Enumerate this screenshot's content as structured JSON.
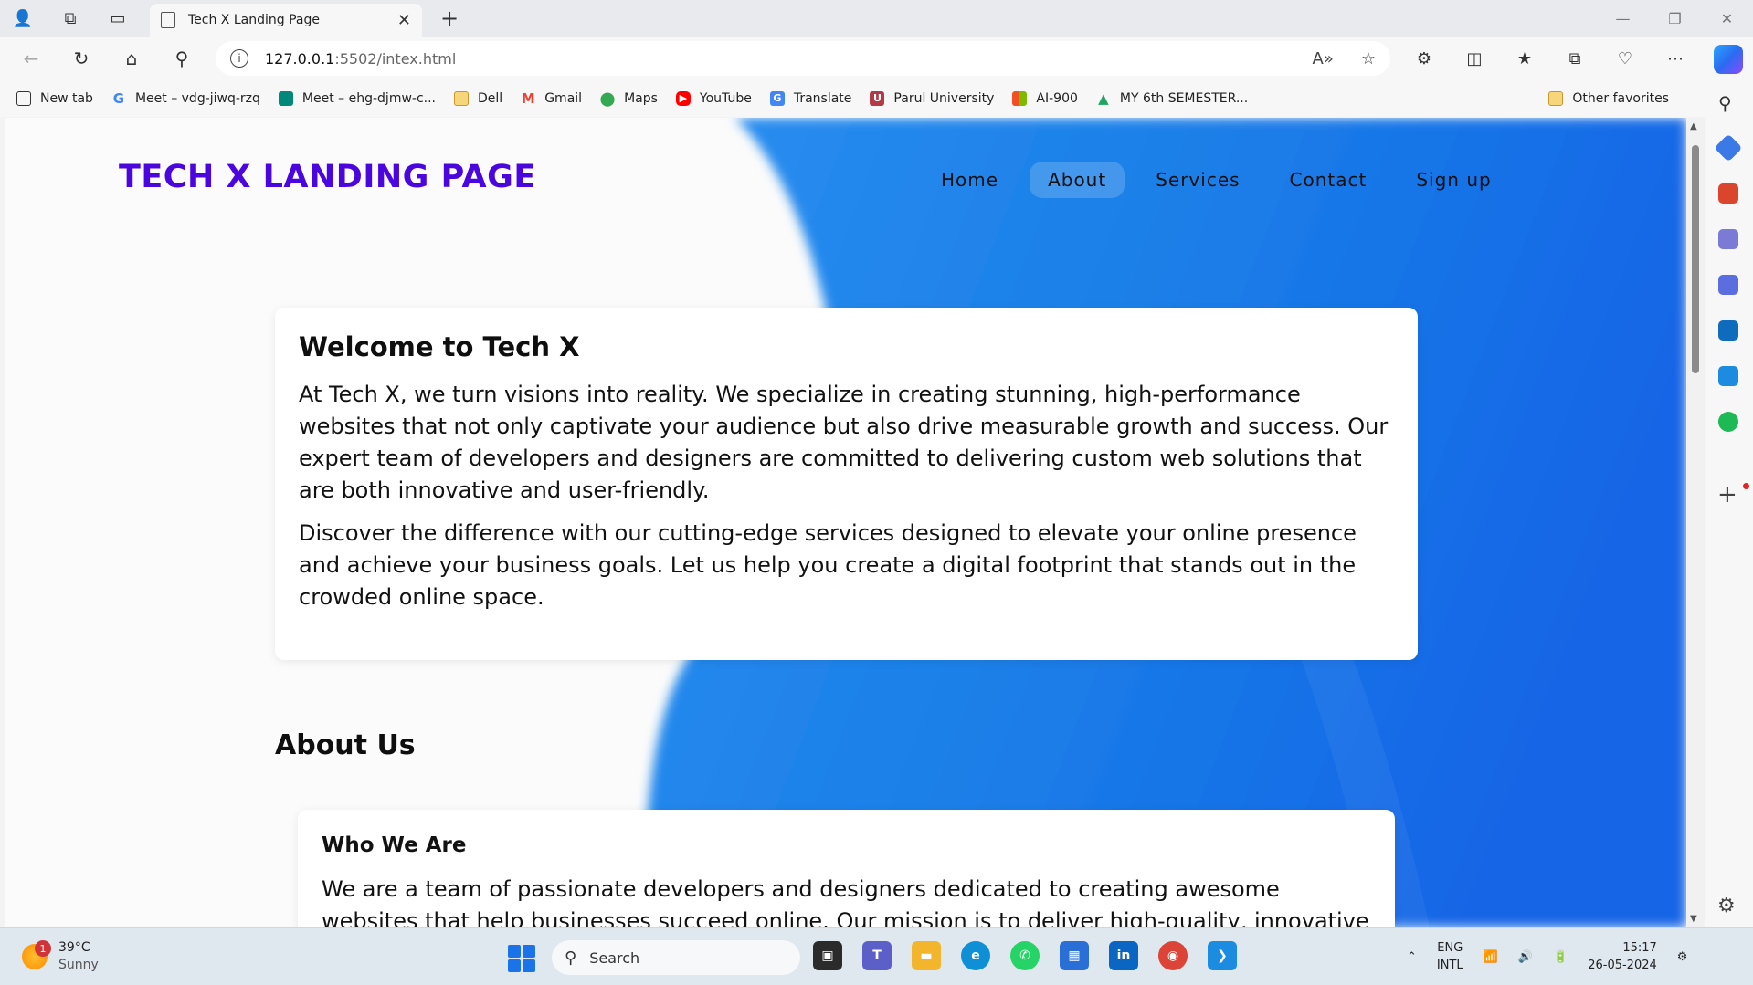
{
  "browser": {
    "tab_title": "Tech X Landing Page",
    "address": {
      "host": "127.0.0.1",
      "rest": ":5502/intex.html"
    },
    "bookmarks": [
      {
        "label": "New tab",
        "icon": "new-tab-icon",
        "color": "#333333"
      },
      {
        "label": "Meet – vdg-jiwq-rzq",
        "icon": "google-icon",
        "color": "#4285f4"
      },
      {
        "label": "Meet – ehg-djmw-c...",
        "icon": "meet-icon",
        "color": "#00897b"
      },
      {
        "label": "Dell",
        "icon": "folder-icon",
        "color": "#e8b43a"
      },
      {
        "label": "Gmail",
        "icon": "gmail-icon",
        "color": "#ea4335"
      },
      {
        "label": "Maps",
        "icon": "maps-icon",
        "color": "#34a853"
      },
      {
        "label": "YouTube",
        "icon": "youtube-icon",
        "color": "#ff0000"
      },
      {
        "label": "Translate",
        "icon": "translate-icon",
        "color": "#4285f4"
      },
      {
        "label": "Parul University",
        "icon": "university-icon",
        "color": "#b23a48"
      },
      {
        "label": "AI-900",
        "icon": "microsoft-icon",
        "color": "#f25022"
      },
      {
        "label": "MY 6th SEMESTER...",
        "icon": "drive-icon",
        "color": "#1fa463"
      }
    ],
    "other_favorites": "Other favorites"
  },
  "site": {
    "brand": "TECH X LANDING PAGE",
    "nav": [
      "Home",
      "About",
      "Services",
      "Contact",
      "Sign up"
    ],
    "active_nav": "About",
    "welcome": {
      "title": "Welcome to Tech X",
      "p1": "At Tech X, we turn visions into reality. We specialize in creating stunning, high-performance websites that not only captivate your audience but also drive measurable growth and success. Our expert team of developers and designers are committed to delivering custom web solutions that are both innovative and user-friendly.",
      "p2": "Discover the difference with our cutting-edge services designed to elevate your online presence and achieve your business goals. Let us help you create a digital footprint that stands out in the crowded online space."
    },
    "about": {
      "title": "About Us",
      "who_title": "Who We Are",
      "who_text": "We are a team of passionate developers and designers dedicated to creating awesome websites that help businesses succeed online. Our mission is to deliver high-quality, innovative"
    },
    "colors": {
      "brand": "#4b06e0",
      "blob": "#1a7fe8"
    }
  },
  "taskbar": {
    "weather": {
      "temp": "39°C",
      "condition": "Sunny",
      "badge": "1"
    },
    "search_placeholder": "Search",
    "lang": {
      "line1": "ENG",
      "line2": "INTL"
    },
    "clock": {
      "time": "15:17",
      "date": "26-05-2024"
    },
    "apps": [
      {
        "icon": "file-manager-icon",
        "color": "#2b2b2b",
        "glyph": "▣"
      },
      {
        "icon": "teams-icon",
        "color": "#5b5fc7",
        "glyph": "T"
      },
      {
        "icon": "file-explorer-icon",
        "color": "#f3b52b",
        "glyph": "▬"
      },
      {
        "icon": "edge-icon",
        "color": "#0f8fd6",
        "glyph": "e"
      },
      {
        "icon": "whatsapp-icon",
        "color": "#25d366",
        "glyph": "✆"
      },
      {
        "icon": "store-icon",
        "color": "#2a6fd6",
        "glyph": "▦"
      },
      {
        "icon": "linkedin-icon",
        "color": "#0a66c2",
        "glyph": "in"
      },
      {
        "icon": "chrome-icon",
        "color": "#db4437",
        "glyph": "◉"
      },
      {
        "icon": "vscode-icon",
        "color": "#1c8ce0",
        "glyph": "❮❯"
      }
    ]
  }
}
